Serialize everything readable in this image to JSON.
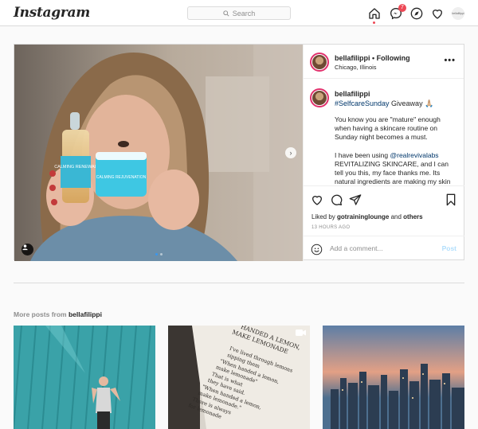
{
  "header": {
    "logo": "Instagram",
    "search_placeholder": "Search",
    "messages_badge": "7",
    "profile_mini": "bellafilippi"
  },
  "post": {
    "username": "bellafilippi",
    "separator": " • ",
    "following": "Following",
    "location": "Chicago, Illinois",
    "more": "•••",
    "caption": {
      "username": "bellafilippi",
      "hashtag": "#SelfcareSunday",
      "giveaway": " Giveaway 🙏🏼",
      "para1": "You know you are \"mature\" enough when having a skincare routine on Sunday night becomes a must.",
      "para2_start": "I have been using ",
      "para2_mention": "@realrevivalabs",
      "para2_end": " REVITALIZING SKINCARE, and I can tell you this, my face thanks me. Its natural ingredients are making my skin"
    },
    "liked_prefix": "Liked by ",
    "liked_user": "gotraininglounge",
    "liked_and": " and ",
    "liked_others": "others",
    "timestamp": "13 HOURS AGO",
    "comment_placeholder": "Add a comment...",
    "post_button": "Post",
    "product_label_1": "CALMING RENEWAL",
    "product_label_2": "CALMING REJUVENATION",
    "carousel": {
      "current": 1,
      "total": 2
    }
  },
  "more_posts": {
    "prefix": "More posts from ",
    "user": "bellafilippi"
  },
  "thumbs": {
    "book_lines": [
      "HANDED A LEMON,",
      "MAKE LEMONADE",
      "I've lived through lemons",
      "sipping them",
      "\"When handed a lemon,",
      "make lemonade\"",
      "That is what",
      "they have said.",
      "\"When handed a lemon,",
      "make lemonade.\"",
      "There is always",
      "for lemonade"
    ]
  },
  "colors": {
    "accent": "#3897f0",
    "badge": "#ed4956",
    "post_button_disabled": "#b2dffc",
    "link": "#00376b"
  }
}
